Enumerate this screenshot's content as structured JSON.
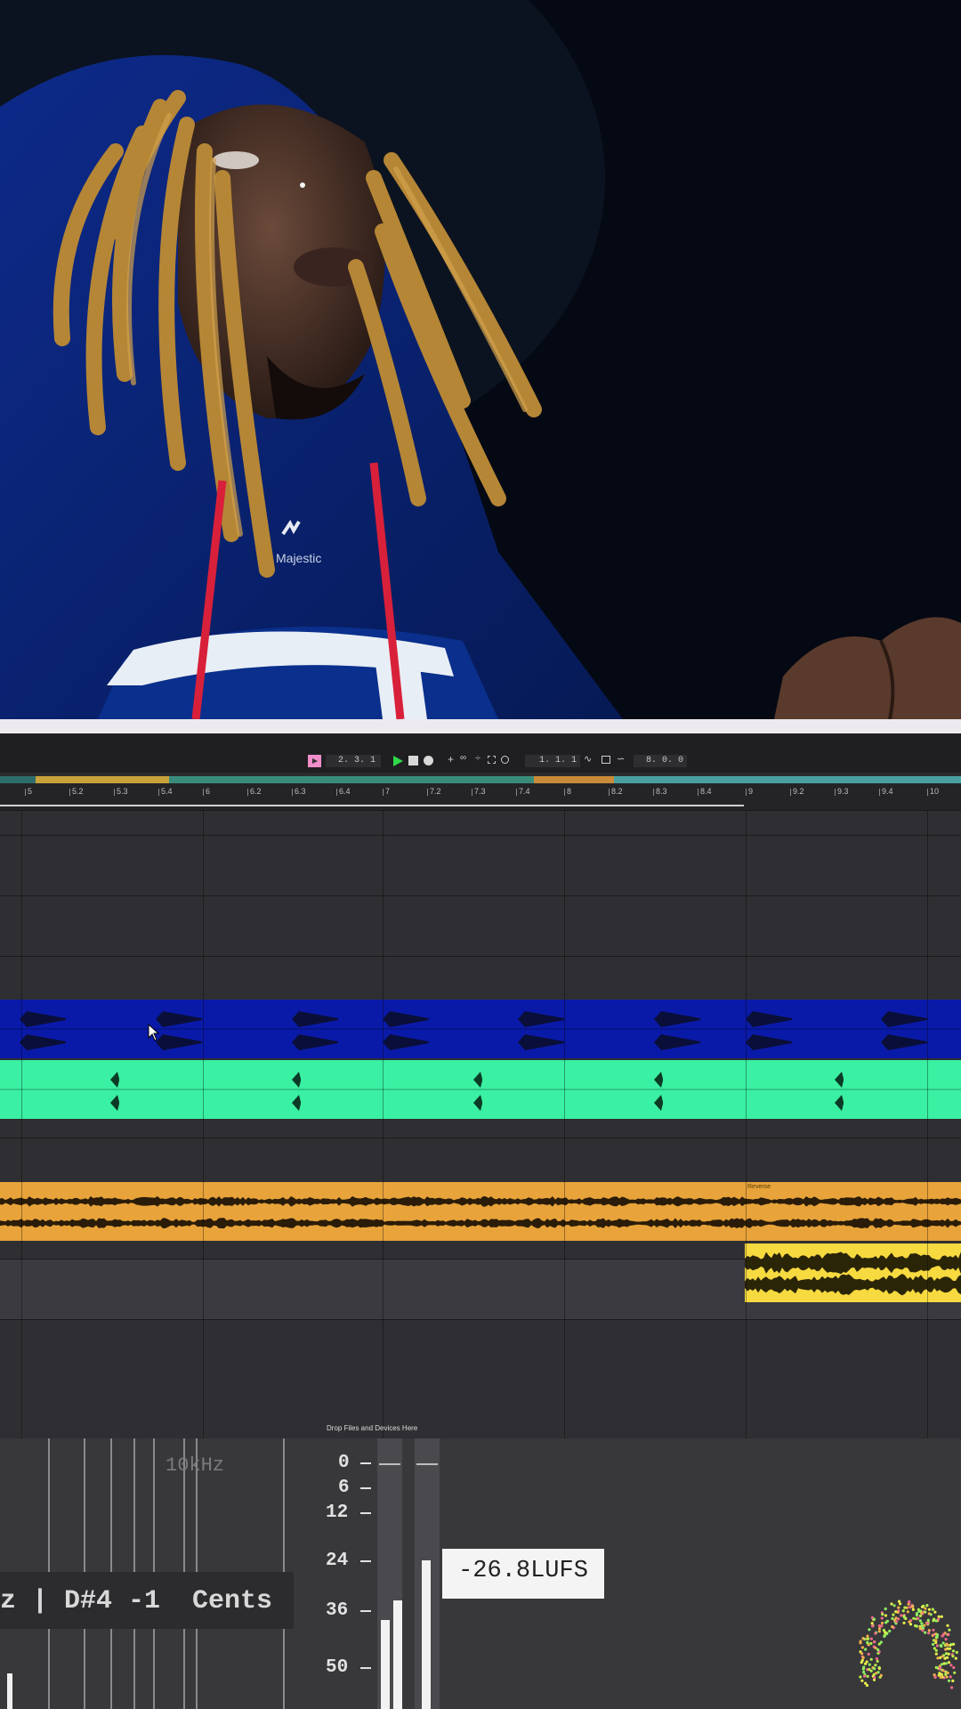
{
  "transport": {
    "arrangement_position": "2. 3. 1",
    "loop_start": "1. 1. 1",
    "loop_length": "8. 0. 0",
    "icons": [
      "arrangement-record-icon",
      "play-icon",
      "stop-icon",
      "record-icon",
      "add-icon",
      "link-icon",
      "metronome-icon",
      "punch-icon",
      "loop-icon",
      "automation-arm-icon",
      "capture-icon",
      "draw-mode-icon"
    ]
  },
  "ruler": {
    "labels": [
      "5",
      "5.2",
      "5.3",
      "5.4",
      "6",
      "6.2",
      "6.3",
      "6.4",
      "7",
      "7.2",
      "7.3",
      "7.4",
      "8",
      "8.2",
      "8.3",
      "8.4",
      "9",
      "9.2",
      "9.3",
      "9.4",
      "10"
    ]
  },
  "clips": {
    "reverse_label": "Reverse"
  },
  "drop_zone": {
    "label": "Drop Files and Devices Here"
  },
  "analyzer": {
    "freq_marker": "10kHz",
    "note_readout": "z | D#4 -1  Cents",
    "db_scale": [
      "0",
      "6",
      "12",
      "24",
      "36",
      "50"
    ],
    "lufs": "-26.8LUFS",
    "meter_levels": [
      0.33,
      0.4,
      0.55
    ]
  },
  "colors": {
    "drum_clip": "#0a1aa8",
    "perc_clip": "#3af0a2",
    "melody_clip": "#e8a33a",
    "reverse_clip": "#f7d940",
    "play": "#2fd84a",
    "arrangement_record": "#f08ec9"
  }
}
